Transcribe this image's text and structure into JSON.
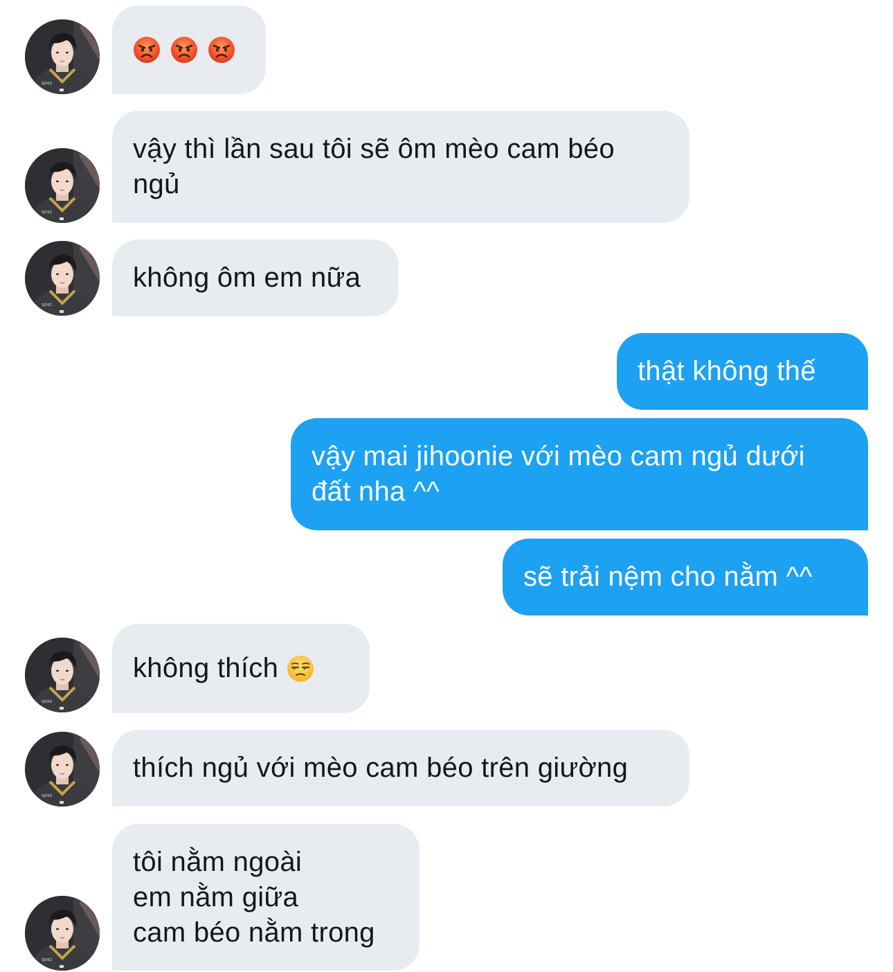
{
  "conversation": {
    "messages": [
      {
        "sender": "other",
        "text": ""
      },
      {
        "sender": "other",
        "text": "vậy thì lần sau tôi sẽ ôm mèo cam béo\nngủ"
      },
      {
        "sender": "other",
        "text": "không ôm em nữa"
      },
      {
        "sender": "me",
        "text": "thật không thế"
      },
      {
        "sender": "me",
        "text": "vậy mai jihoonie với mèo cam ngủ dưới\nđất nha ^^"
      },
      {
        "sender": "me",
        "text": "sẽ trải nệm cho nằm ^^"
      },
      {
        "sender": "other",
        "text": "không thích "
      },
      {
        "sender": "other",
        "text": "thích ngủ với mèo cam béo trên giường"
      },
      {
        "sender": "other",
        "text": "tôi nằm ngoài\nem nằm giữa\ncam béo nằm trong"
      }
    ],
    "emoji": {
      "message_0": [
        "angry-face",
        "angry-face",
        "angry-face"
      ],
      "message_6": "unamused-face"
    },
    "colors": {
      "incoming_bubble": "#e8ecf0",
      "outgoing_bubble": "#1da1f2",
      "incoming_text": "#14171a",
      "outgoing_text": "#ffffff"
    }
  }
}
